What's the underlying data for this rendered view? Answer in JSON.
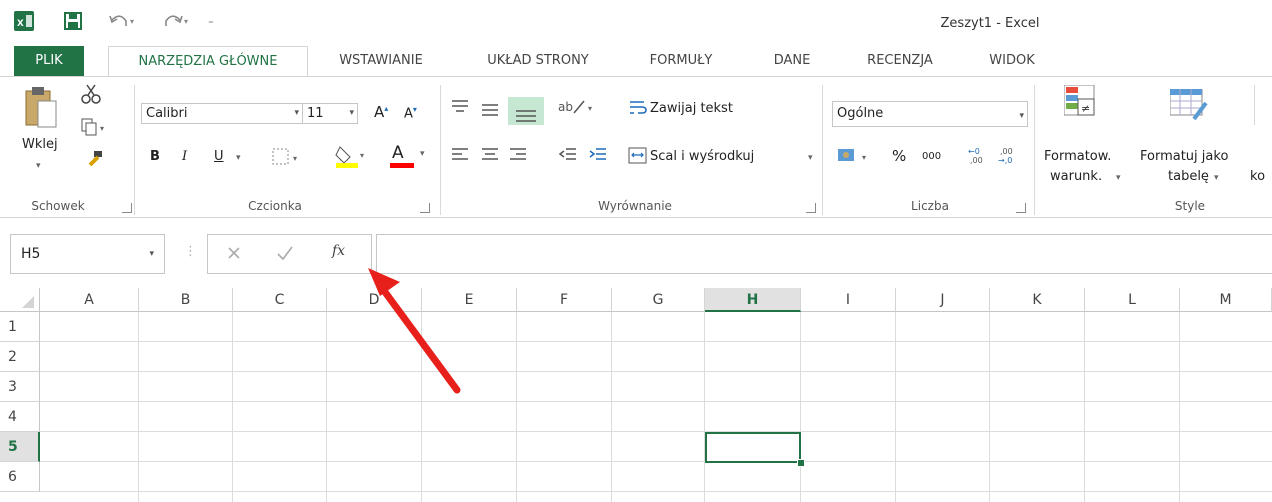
{
  "window": {
    "title": "Zeszyt1 - Excel"
  },
  "quick_access": {
    "undo_icon": "undo-icon",
    "redo_icon": "redo-icon",
    "save_icon": "save-icon"
  },
  "tabs": [
    {
      "label": "PLIK"
    },
    {
      "label": "NARZĘDZIA GŁÓWNE"
    },
    {
      "label": "WSTAWIANIE"
    },
    {
      "label": "UKŁAD STRONY"
    },
    {
      "label": "FORMUŁY"
    },
    {
      "label": "DANE"
    },
    {
      "label": "RECENZJA"
    },
    {
      "label": "WIDOK"
    }
  ],
  "ribbon": {
    "clipboard": {
      "paste_label": "Wklej",
      "group_label": "Schowek"
    },
    "font": {
      "font_name": "Calibri",
      "font_size": "11",
      "grow": "A",
      "shrink": "A",
      "bold": "B",
      "italic": "I",
      "underline": "U",
      "font_color": "A",
      "group_label": "Czcionka"
    },
    "alignment": {
      "wrap_text": "Zawijaj tekst",
      "merge_center": "Scal i wyśrodkuj",
      "group_label": "Wyrównanie"
    },
    "number": {
      "format": "Ogólne",
      "percent": "%",
      "thousands": "000",
      "group_label": "Liczba"
    },
    "styles": {
      "cond_format_1": "Formatow.",
      "cond_format_2": "warunk.",
      "format_table_1": "Formatuj jako",
      "format_table_2": "tabelę",
      "cut_off": "ko",
      "group_label": "Style"
    }
  },
  "formula_bar": {
    "name_box": "H5",
    "fx": "fx",
    "formula": ""
  },
  "grid": {
    "columns": [
      "A",
      "B",
      "C",
      "D",
      "E",
      "F",
      "G",
      "H",
      "I",
      "J",
      "K",
      "L",
      "M"
    ],
    "rows": [
      "1",
      "2",
      "3",
      "4",
      "5",
      "6"
    ],
    "selected_column": "H",
    "selected_row": "5"
  },
  "colors": {
    "accent": "#217346",
    "annotation_arrow": "#e8201b",
    "font_color_bar": "#ff0000",
    "fill_color_bar": "#ffff00"
  }
}
